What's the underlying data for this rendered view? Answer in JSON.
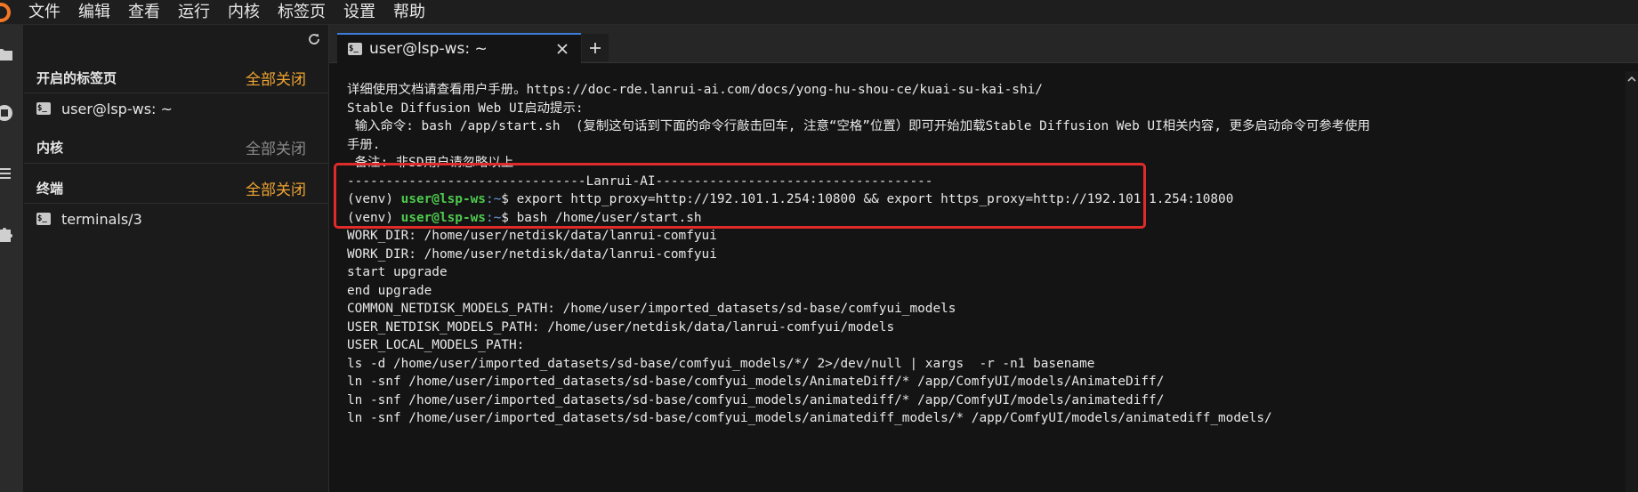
{
  "menubar": {
    "items": [
      "文件",
      "编辑",
      "查看",
      "运行",
      "内核",
      "标签页",
      "设置",
      "帮助"
    ]
  },
  "activity_icons": [
    "folder-icon",
    "stop-circle-icon",
    "list-icon",
    "puzzle-icon"
  ],
  "sidebar": {
    "open_tabs": {
      "heading": "开启的标签页",
      "close_all": "全部关闭",
      "items": [
        "user@lsp-ws: ~"
      ]
    },
    "kernels": {
      "heading": "内核",
      "close_all": "全部关闭"
    },
    "terminals": {
      "heading": "终端",
      "close_all": "全部关闭",
      "items": [
        "terminals/3"
      ]
    }
  },
  "tab": {
    "label": "user@lsp-ws: ~"
  },
  "terminal": {
    "lines": [
      "详细使用文档请查看用户手册。https://doc-rde.lanrui-ai.com/docs/yong-hu-shou-ce/kuai-su-kai-shi/",
      "Stable Diffusion Web UI启动提示:",
      " 输入命令: bash /app/start.sh  (复制这句话到下面的命令行敲击回车, 注意“空格”位置）即可开始加载Stable Diffusion Web UI相关内容, 更多启动命令可参考使用",
      "手册.",
      " 备注: 非SD用户请忽略以上",
      "-------------------------------Lanrui-AI------------------------------------",
      "WORK_DIR: /home/user/netdisk/data/lanrui-comfyui",
      "WORK_DIR: /home/user/netdisk/data/lanrui-comfyui",
      "start upgrade",
      "end upgrade",
      "COMMON_NETDISK_MODELS_PATH: /home/user/imported_datasets/sd-base/comfyui_models",
      "USER_NETDISK_MODELS_PATH: /home/user/netdisk/data/lanrui-comfyui/models",
      "USER_LOCAL_MODELS_PATH:",
      "ls -d /home/user/imported_datasets/sd-base/comfyui_models/*/ 2>/dev/null | xargs  -r -n1 basename",
      "ln -snf /home/user/imported_datasets/sd-base/comfyui_models/AnimateDiff/* /app/ComfyUI/models/AnimateDiff/",
      "ln -snf /home/user/imported_datasets/sd-base/comfyui_models/animatediff/* /app/ComfyUI/models/animatediff/",
      "ln -snf /home/user/imported_datasets/sd-base/comfyui_models/animatediff_models/* /app/ComfyUI/models/animatediff_models/"
    ],
    "prompt": {
      "venv": "(venv)",
      "user": "user@lsp-ws",
      "path": ":~",
      "symbol": "$"
    },
    "commands": [
      "export http_proxy=http://192.101.1.254:10800 && export https_proxy=http://192.101.1.254:10800",
      "bash /home/user/start.sh"
    ]
  },
  "colors": {
    "accent": "#f0a432",
    "highlight": "#e02b2b",
    "prompt_green": "#4ec94e",
    "tab_border": "#3b7ddd"
  }
}
